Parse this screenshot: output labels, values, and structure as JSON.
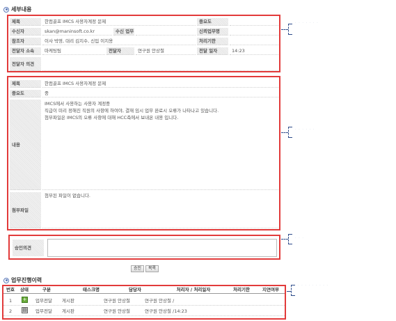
{
  "sections": {
    "detail_title": "세부내용",
    "history_title": "업무진행이력"
  },
  "header_fields": {
    "title_label": "제목",
    "title_value": "한컴골프 IMCS 사용자계정 문제",
    "importance_label": "중요도",
    "importance_value": "",
    "receiver_label": "수신자",
    "receiver_value": "skan@maninsoft.co.kr",
    "receive_task_label": "수신 업무",
    "receive_task_value": "",
    "deadline_req_label": "신뢰업무명",
    "deadline_req_value": "",
    "cc_label": "참조자",
    "cc_value": "이사 박영, 대리 김지수, 신입 이지용",
    "deadline_label": "처리기한",
    "deadline_value": "",
    "assignee_dept_label": "전달자 소속",
    "assignee_dept_value": "마케팅팀",
    "assignee_label": "전달자",
    "assignee_value": "연구원 안상철",
    "sent_date_label": "전달 일자",
    "sent_date_value": "14:23",
    "opinion_label": "전달자 의견",
    "opinion_value": ""
  },
  "content_fields": {
    "title_label": "제목",
    "title_value": "한컴골프 IMCS 사용자계정 문제",
    "importance_label": "중요도",
    "importance_value": "중",
    "content_label": "내용",
    "content_lines": [
      "IMCS에서 사용하는 사용자 계정중",
      "직급이 미리 정해진 직원의 사항에 하여야, 결재 임시 업무 완료시 오류가 나타나고 있습니다.",
      "첨부파일은 IMCS의 오류 사항에 대해 HCC측에서 보내온 내용 입니다."
    ],
    "attachment_label": "첨부파일",
    "attachment_value": "첨부된 파일이 없습니다."
  },
  "review": {
    "label": "승인의견",
    "value": ""
  },
  "buttons": {
    "approve": "승인",
    "list": "목록"
  },
  "history": {
    "columns": [
      "번호",
      "상태",
      "구분",
      "태스크명",
      "담당자",
      "처리자 / 처리일자",
      "처리기한",
      "지연여부"
    ],
    "rows": [
      {
        "no": "1",
        "status_icon": "plus-icon",
        "type": "업무전달",
        "task": "게시판",
        "owner": "연구원 안상철",
        "processor": "연구원 안상철 /",
        "deadline": "",
        "delay": ""
      },
      {
        "no": "2",
        "status_icon": "document-icon",
        "type": "업무전달",
        "task": "게시판",
        "owner": "연구원 안상철",
        "processor": "연구원 안상철 /14:23",
        "deadline": "",
        "delay": ""
      }
    ]
  },
  "colors": {
    "highlight_border": "#e23a3a",
    "callout": "#2c4a8a",
    "label_bg": "#ececec"
  }
}
